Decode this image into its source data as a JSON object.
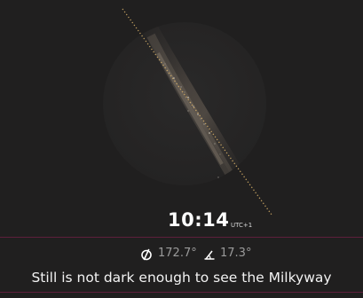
{
  "sky": {
    "accent_line_color": "#d8b26a",
    "disc_color": "#262525",
    "background_color": "#201f1f"
  },
  "time": {
    "value": "10:14",
    "timezone": "UTC+1"
  },
  "position": {
    "azimuth_icon": "compass-icon",
    "azimuth": "172.7°",
    "altitude_icon": "angle-icon",
    "altitude": "17.3°"
  },
  "status": {
    "message": "Still is not dark enough to see the Milkyway"
  },
  "colors": {
    "divider": "#5e1f3c",
    "secondary_text": "#9a9a9a"
  }
}
